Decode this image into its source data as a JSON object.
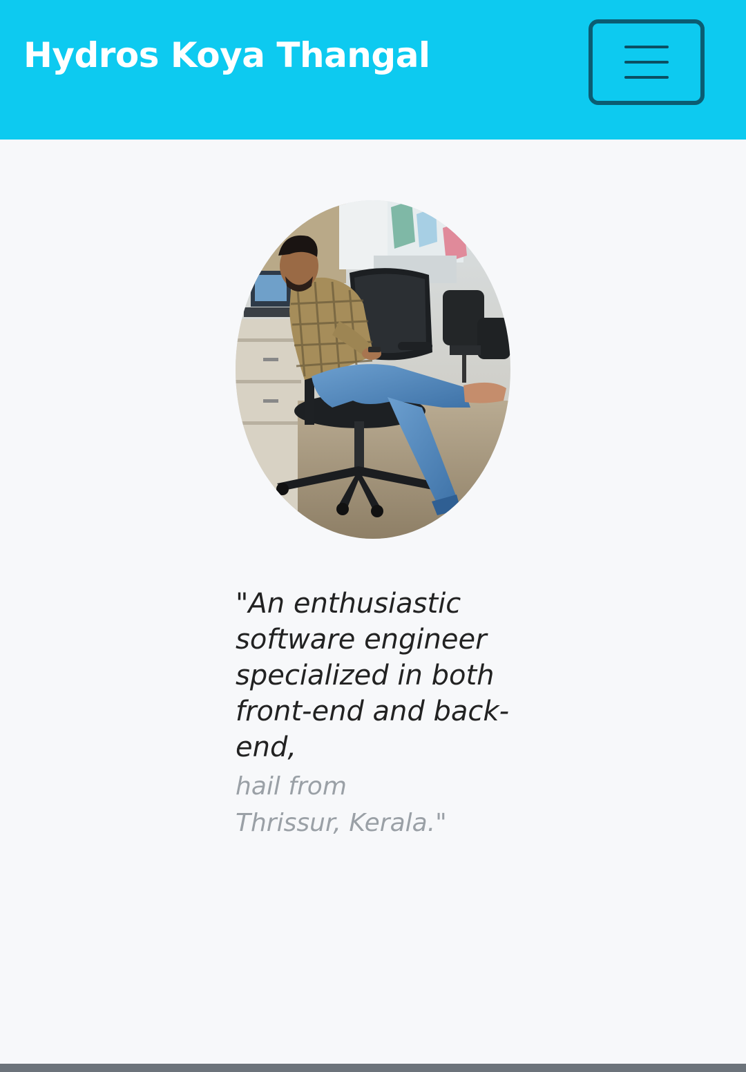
{
  "navbar": {
    "brand": "Hydros Koya Thangal",
    "toggle_icon": "hamburger-menu-icon",
    "background_color": "#0dcaf0"
  },
  "profile": {
    "photo_subject": "profile-photo"
  },
  "quote": {
    "main": "\"An enthusiastic software engineer specialized in both front-end and back-end,",
    "sub": "hail from Thrissur, Kerala.\""
  }
}
